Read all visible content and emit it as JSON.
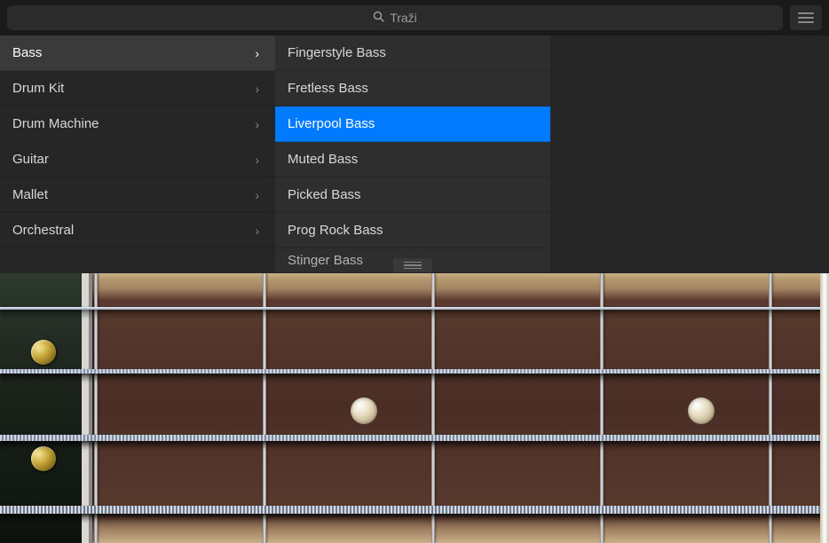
{
  "search": {
    "placeholder": "Traži"
  },
  "categories": [
    {
      "label": "Bass",
      "selected": true
    },
    {
      "label": "Drum Kit",
      "selected": false
    },
    {
      "label": "Drum Machine",
      "selected": false
    },
    {
      "label": "Guitar",
      "selected": false
    },
    {
      "label": "Mallet",
      "selected": false
    },
    {
      "label": "Orchestral",
      "selected": false
    }
  ],
  "presets": [
    {
      "label": "Fingerstyle Bass",
      "selected": false
    },
    {
      "label": "Fretless Bass",
      "selected": false
    },
    {
      "label": "Liverpool Bass",
      "selected": true
    },
    {
      "label": "Muted Bass",
      "selected": false
    },
    {
      "label": "Picked Bass",
      "selected": false
    },
    {
      "label": "Prog Rock Bass",
      "selected": false
    },
    {
      "label": "Stinger Bass",
      "selected": false
    }
  ]
}
